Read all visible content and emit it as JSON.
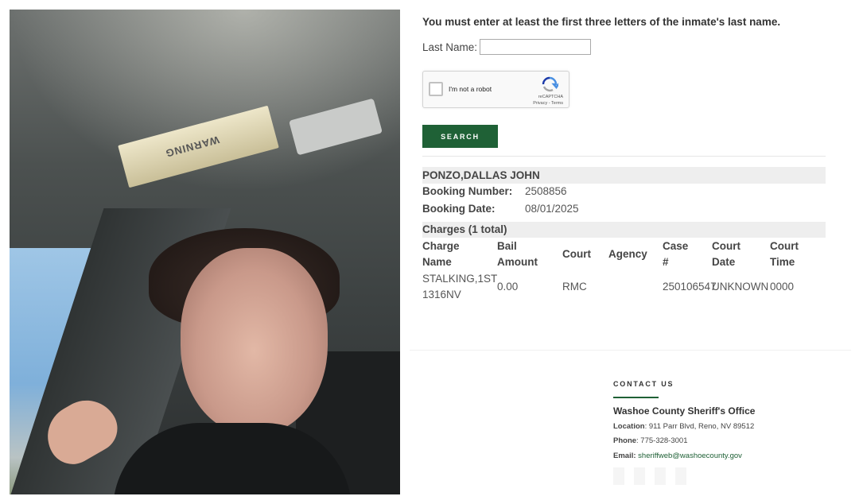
{
  "search": {
    "instruction": "You must enter at least the first three letters of the inmate's last name.",
    "last_name_label": "Last Name:",
    "last_name_value": "",
    "button_label": "SEARCH"
  },
  "captcha": {
    "label": "I'm not a robot",
    "brand": "reCAPTCHA",
    "links": "Privacy - Terms"
  },
  "inmate": {
    "name": "PONZO,DALLAS JOHN",
    "booking_number_label": "Booking Number:",
    "booking_number": "2508856",
    "booking_date_label": "Booking Date:",
    "booking_date": "08/01/2025"
  },
  "charges": {
    "title": "Charges (1 total)",
    "headers": {
      "charge_name_1": "Charge",
      "charge_name_2": "Name",
      "bail_amount_1": "Bail",
      "bail_amount_2": "Amount",
      "court": "Court",
      "agency": "Agency",
      "case_1": "Case",
      "case_2": "#",
      "court_date_1": "Court",
      "court_date_2": "Date",
      "court_time_1": "Court",
      "court_time_2": "Time"
    },
    "rows": [
      {
        "charge_name_1": "STALKING,1ST",
        "charge_name_2": "1316NV",
        "bail_amount": "0.00",
        "court": "RMC",
        "agency": "",
        "case_number": "250106547",
        "court_date": "UNKNOWN",
        "court_time": "0000"
      }
    ]
  },
  "contact": {
    "title": "CONTACT US",
    "office": "Washoe County Sheriff's Office",
    "location_label": "Location",
    "location": ": 911 Parr Blvd, Reno, NV 89512",
    "phone_label": "Phone",
    "phone": ": 775-328-3001",
    "email_label": "Email:",
    "email": "sheriffweb@washoecounty.gov"
  },
  "photo": {
    "visor_text": "WARNING"
  },
  "colors": {
    "accent": "#1f6136",
    "bar_bg": "#eeeeee"
  }
}
